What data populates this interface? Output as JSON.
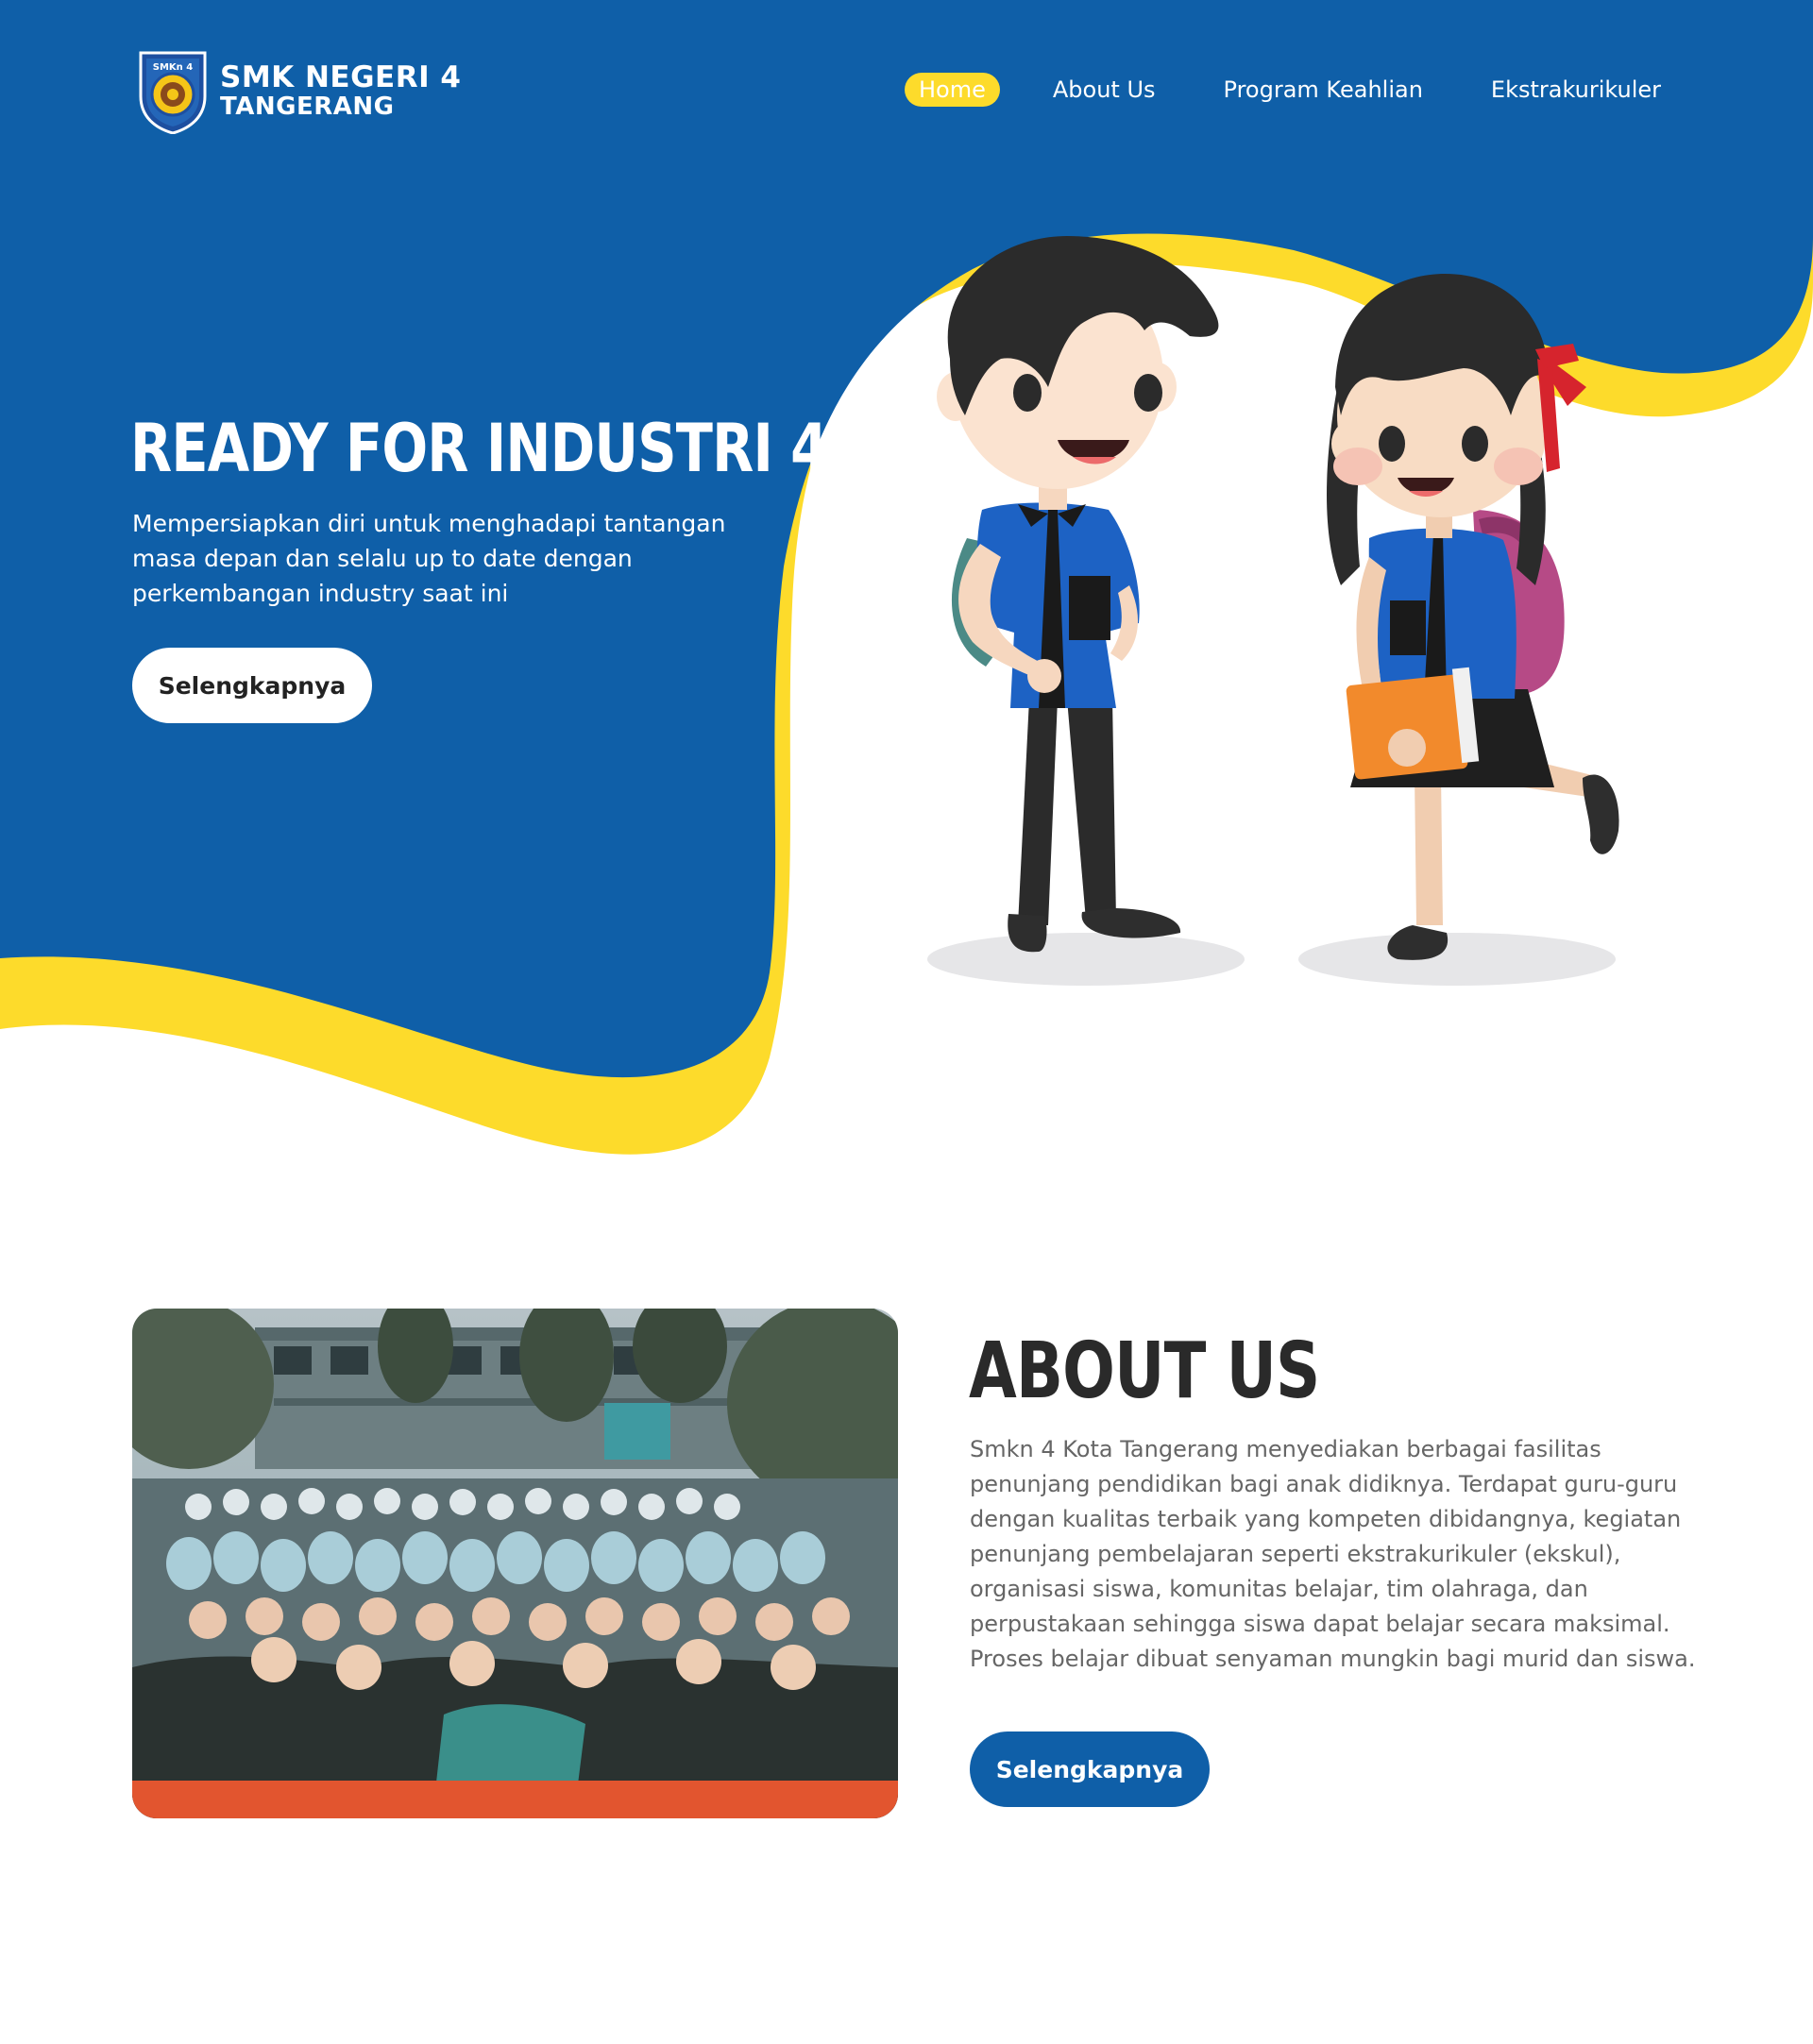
{
  "colors": {
    "brand_blue": "#0f5fa8",
    "accent_yellow": "#fddb2b",
    "white": "#ffffff",
    "heading_dark": "#2a2a2a",
    "body_gray": "#666666"
  },
  "header": {
    "logo": {
      "icon": "school-emblem-icon",
      "badge_text": "SMKn 4",
      "line1": "SMK NEGERI 4",
      "line2": "TANGERANG"
    },
    "nav": [
      {
        "label": "Home",
        "active": true
      },
      {
        "label": "About Us",
        "active": false
      },
      {
        "label": "Program Keahlian",
        "active": false
      },
      {
        "label": "Ekstrakurikuler",
        "active": false
      }
    ]
  },
  "hero": {
    "title": "READY FOR INDUSTRI 4.0",
    "subtitle": "Mempersiapkan diri untuk menghadapi tantangan masa depan dan selalu up to date dengan perkembangan industry saat ini",
    "button_label": "Selengkapnya",
    "illustration": "students-illustration"
  },
  "about": {
    "photo": "students-group-photo",
    "title": "ABOUT US",
    "body": "Smkn 4 Kota Tangerang menyediakan berbagai fasilitas penunjang pendidikan bagi anak didiknya. Terdapat guru-guru dengan kualitas terbaik yang kompeten dibidangnya, kegiatan penunjang pembelajaran seperti ekstrakurikuler (ekskul), organisasi siswa, komunitas belajar, tim olahraga, dan perpustakaan sehingga siswa dapat belajar secara maksimal. Proses belajar dibuat senyaman mungkin bagi murid dan siswa.",
    "button_label": "Selengkapnya"
  }
}
